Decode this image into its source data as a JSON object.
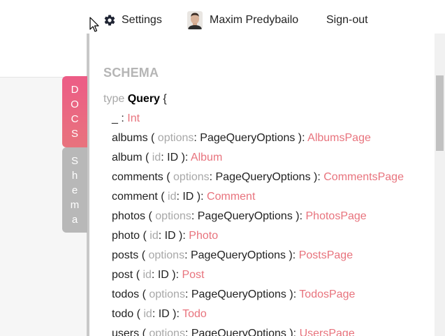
{
  "header": {
    "settings_label": "Settings",
    "user_name": "Maxim Predybailo",
    "signout_label": "Sign-out"
  },
  "tabs": {
    "docs": [
      "D",
      "O",
      "C",
      "S"
    ],
    "schema": [
      "S",
      "h",
      "e",
      "m",
      "a"
    ]
  },
  "docs": {
    "section_title": "SCHEMA",
    "type_keyword": "type",
    "type_name": "Query",
    "open_brace": "{",
    "fields": [
      {
        "name": "_",
        "open": "",
        "arg": "",
        "argtype": "",
        "close": " : ",
        "ret": "Int"
      },
      {
        "name": "albums",
        "open": " ( ",
        "arg": "options",
        "argtype": ": PageQueryOptions",
        "close": " ): ",
        "ret": "AlbumsPage"
      },
      {
        "name": "album",
        "open": " ( ",
        "arg": "id",
        "argtype": ": ID",
        "close": " ): ",
        "ret": "Album"
      },
      {
        "name": "comments",
        "open": " ( ",
        "arg": "options",
        "argtype": ": PageQueryOptions",
        "close": " ): ",
        "ret": "CommentsPage"
      },
      {
        "name": "comment",
        "open": " ( ",
        "arg": "id",
        "argtype": ": ID",
        "close": " ): ",
        "ret": "Comment"
      },
      {
        "name": "photos",
        "open": " ( ",
        "arg": "options",
        "argtype": ": PageQueryOptions",
        "close": " ): ",
        "ret": "PhotosPage"
      },
      {
        "name": "photo",
        "open": " ( ",
        "arg": "id",
        "argtype": ": ID",
        "close": " ): ",
        "ret": "Photo"
      },
      {
        "name": "posts",
        "open": " ( ",
        "arg": "options",
        "argtype": ": PageQueryOptions",
        "close": " ): ",
        "ret": "PostsPage"
      },
      {
        "name": "post",
        "open": " ( ",
        "arg": "id",
        "argtype": ": ID",
        "close": " ): ",
        "ret": "Post"
      },
      {
        "name": "todos",
        "open": " ( ",
        "arg": "options",
        "argtype": ": PageQueryOptions",
        "close": " ): ",
        "ret": "TodosPage"
      },
      {
        "name": "todo",
        "open": " ( ",
        "arg": "id",
        "argtype": ": ID",
        "close": " ): ",
        "ret": "Todo"
      },
      {
        "name": "users",
        "open": " ( ",
        "arg": "options",
        "argtype": ": PageQueryOptions",
        "close": " ): ",
        "ret": "UsersPage"
      }
    ]
  },
  "colors": {
    "accent": "#e8737d",
    "muted": "#a8a8a8",
    "docs_tab": "#ec5c86",
    "schema_tab": "#b8b8b8"
  },
  "icons": {
    "settings": "gear-icon",
    "user": "avatar",
    "cursor": "mouse-pointer-icon"
  }
}
